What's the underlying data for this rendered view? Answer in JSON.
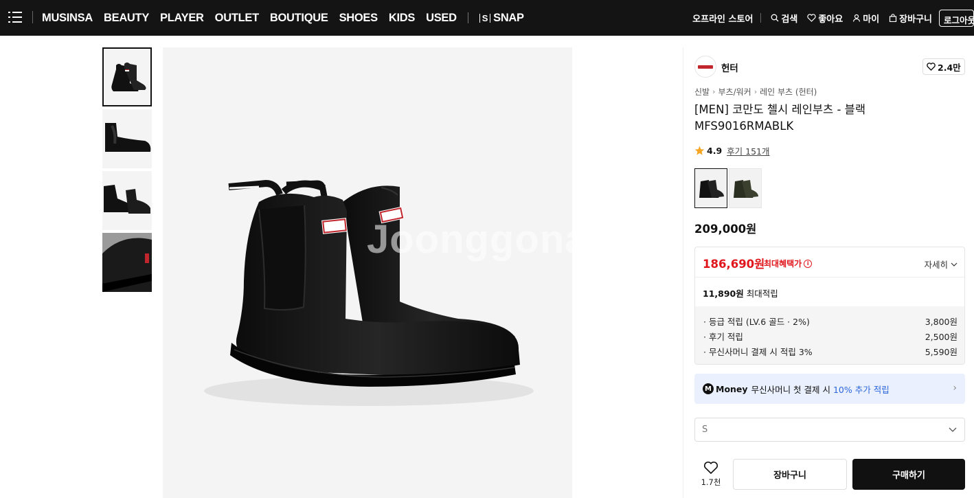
{
  "header": {
    "nav": [
      "MUSINSA",
      "BEAUTY",
      "PLAYER",
      "OUTLET",
      "BOUTIQUE",
      "SHOES",
      "KIDS",
      "USED"
    ],
    "snap_prefix": "S",
    "snap_label": "SNAP",
    "utils": {
      "offline_store": "오프라인 스토어",
      "search": "검색",
      "like": "좋아요",
      "my": "마이",
      "cart": "장바구니",
      "logout": "로그아웃"
    }
  },
  "gallery": {
    "thumbnail_count": 4,
    "watermark": "Joonggonara"
  },
  "product": {
    "brand": "헌터",
    "brand_likes": "2.4만",
    "breadcrumb": [
      "신발",
      "부츠/워커",
      "레인 부츠 (헌터)"
    ],
    "title": "[MEN] 코만도 첼시 레인부츠 - 블랙 MFS9016RMABLK",
    "rating": "4.9",
    "reviews": "후기 151개",
    "original_price": "209,000원",
    "sale_price": "186,690원",
    "sale_label": "최대혜택가",
    "detail_label": "자세히",
    "max_accrual_amount": "11,890원",
    "max_accrual_label": "최대적립",
    "accrual_rows": [
      {
        "label": "· 등급 적립 (LV.6 골드 · 2%)",
        "value": "3,800원"
      },
      {
        "label": "· 후기 적립",
        "value": "2,500원"
      },
      {
        "label": "· 무신사머니 결제 시 적립 3%",
        "value": "5,590원"
      }
    ],
    "money_banner": {
      "badge": "M",
      "word": "Money",
      "text": "무신사머니 첫 결제 시",
      "highlight": "10% 추가 적립"
    },
    "size_selected": "S",
    "wish_count": "1.7천",
    "cart_button": "장바구니",
    "buy_button": "구매하기"
  },
  "colors": {
    "topbar": "#141414",
    "sale_red": "#e0161c",
    "money_blue": "#2b66dc",
    "money_bg": "#eaf0fd"
  }
}
